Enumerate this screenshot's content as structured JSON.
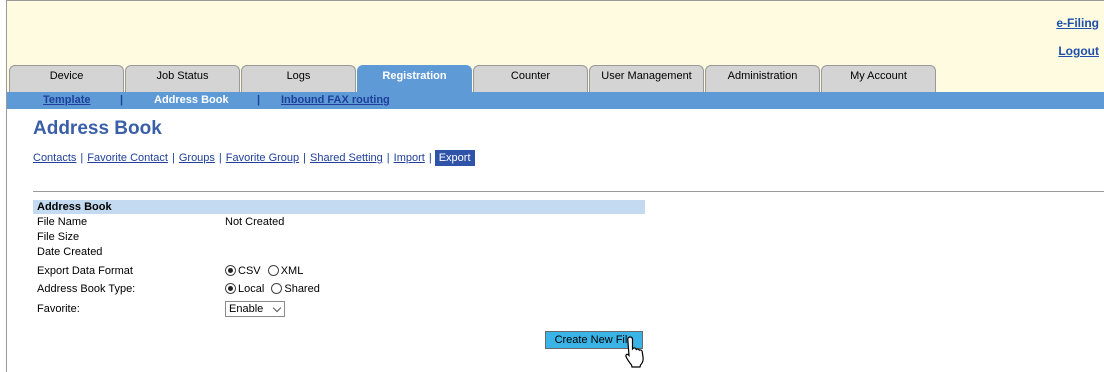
{
  "header": {
    "efiling_link": "e-Filing",
    "logout_link": "Logout"
  },
  "tabs": [
    {
      "label": "Device"
    },
    {
      "label": "Job Status"
    },
    {
      "label": "Logs"
    },
    {
      "label": "Registration",
      "active": true
    },
    {
      "label": "Counter"
    },
    {
      "label": "User Management"
    },
    {
      "label": "Administration"
    },
    {
      "label": "My Account"
    }
  ],
  "subnav": {
    "template": "Template",
    "sep1": "|",
    "address_book": "Address Book",
    "sep2": "|",
    "inbound_fax": "Inbound FAX routing"
  },
  "page_title": "Address Book",
  "submenu": {
    "contacts": "Contacts",
    "favorite_contact": "Favorite Contact",
    "groups": "Groups",
    "favorite_group": "Favorite Group",
    "shared_setting": "Shared Setting",
    "import": "Import",
    "export": "Export",
    "separator": "|"
  },
  "section": {
    "header": "Address Book",
    "file_name_label": "File Name",
    "file_name_value": "Not Created",
    "file_size_label": "File Size",
    "date_created_label": "Date Created",
    "export_format_label": "Export Data Format",
    "export_format_options": [
      "CSV",
      "XML"
    ],
    "export_format_selected": "CSV",
    "book_type_label": "Address Book Type:",
    "book_type_options": [
      "Local",
      "Shared"
    ],
    "book_type_selected": "Local",
    "favorite_label": "Favorite:",
    "favorite_value": "Enable"
  },
  "buttons": {
    "create_new_file": "Create New File"
  },
  "colors": {
    "accent_blue": "#5d9ad6",
    "title_blue": "#3a5fa8",
    "button_cyan": "#3ab4e6",
    "header_bg": "#fffbe0",
    "section_bg": "#c4daf0"
  }
}
